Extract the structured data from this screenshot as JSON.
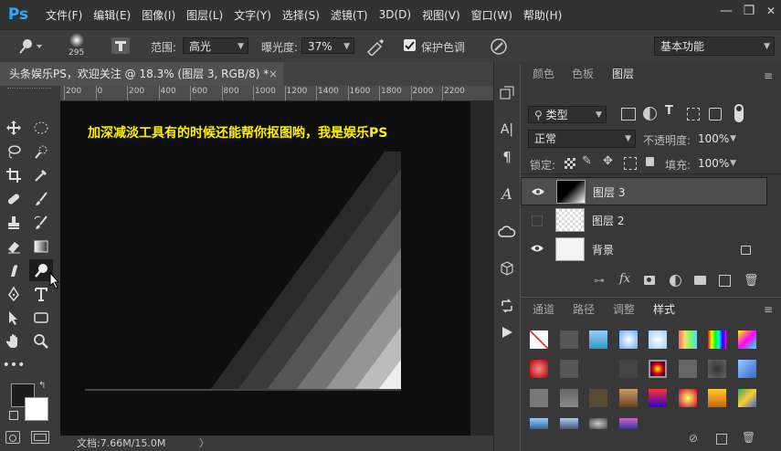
{
  "app": {
    "logo": "Ps"
  },
  "menu": [
    "文件(F)",
    "编辑(E)",
    "图像(I)",
    "图层(L)",
    "文字(Y)",
    "选择(S)",
    "滤镜(T)",
    "3D(D)",
    "视图(V)",
    "窗口(W)",
    "帮助(H)"
  ],
  "window_controls": {
    "minimize": "—",
    "restore": "❐",
    "close": "✕"
  },
  "options": {
    "brush_size": "295",
    "range_label": "范围:",
    "range_value": "高光",
    "exposure_label": "曝光度:",
    "exposure_value": "37%",
    "protect_label": "保护色调",
    "protect_checked": true,
    "workspace": "基本功能"
  },
  "document": {
    "tab_title": "头条娱乐PS，欢迎关注 @ 18.3% (图层 3, RGB/8) *",
    "tab_close": "×",
    "canvas_text": "加深减淡工具有的时候还能帮你抠图哟，我是娱乐PS",
    "canvas_text_color": "#ffef00",
    "status": "文档:7.66M/15.0M",
    "status_arrow": "〉"
  },
  "ruler": {
    "ticks": [
      "200",
      "0",
      "200",
      "400",
      "600",
      "800",
      "1000",
      "1200",
      "1400",
      "1600",
      "1800",
      "2000",
      "2200"
    ]
  },
  "layers_panel": {
    "tabs": [
      "颜色",
      "色板",
      "图层"
    ],
    "active_tab": "图层",
    "filter_label": "类型",
    "blend_mode": "正常",
    "opacity_label": "不透明度:",
    "opacity_value": "100%",
    "lock_label": "锁定:",
    "fill_label": "填充:",
    "fill_value": "100%",
    "layers": [
      {
        "name": "图层 3",
        "visible": true,
        "selected": true
      },
      {
        "name": "图层 2",
        "visible": false,
        "selected": false
      },
      {
        "name": "背景",
        "visible": true,
        "selected": false,
        "locked": true
      }
    ]
  },
  "styles_panel": {
    "tabs": [
      "通道",
      "路径",
      "调整",
      "样式"
    ],
    "active_tab": "样式"
  },
  "colors": {
    "foreground": "#1c1c1c",
    "background": "#ffffff",
    "accent": "#31a8ff"
  }
}
